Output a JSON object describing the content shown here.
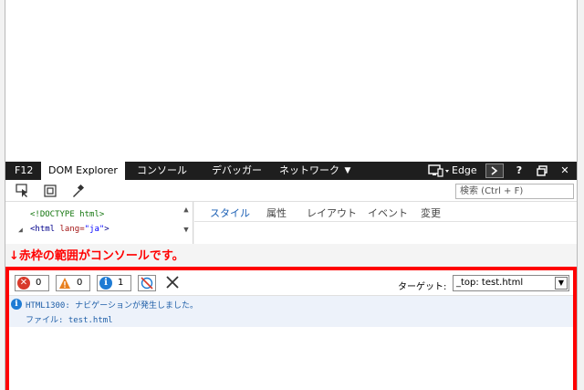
{
  "devtools": {
    "tabs": {
      "f12": "F12",
      "dom_explorer": "DOM Explorer",
      "console": "コンソール",
      "debugger": "デバッガー",
      "network": "ネットワーク"
    },
    "target_browser": "Edge",
    "search_placeholder": "検索 (Ctrl + F)"
  },
  "dom_tree": {
    "line1": "<!DOCTYPE html>",
    "line2_tag": "<html",
    "line2_attr": "lang=",
    "line2_value": "\"ja\"",
    "line2_close": ">"
  },
  "style_tabs": [
    "スタイル",
    "属性",
    "レイアウト",
    "イベント",
    "変更"
  ],
  "annotation": "↓赤枠の範囲がコンソールです。",
  "console": {
    "errors_count": "0",
    "warnings_count": "0",
    "info_count": "1",
    "target_label": "ターゲット:",
    "target_value": "_top: test.html",
    "messages": [
      {
        "line1": "HTML1300: ナビゲーションが発生しました。",
        "line2": "ファイル: test.html"
      }
    ]
  },
  "colors": {
    "highlight_border": "#ff0000",
    "annotation_text": "#ff0000",
    "active_style_tab": "#1a5fb4",
    "devtools_tabbar": "#1e1e1e"
  },
  "icons": [
    "select-element-icon",
    "dom-box-icon",
    "color-picker-icon",
    "emulation-icon",
    "console-icon",
    "help-icon",
    "undock-icon",
    "close-icon",
    "error-icon",
    "warning-icon",
    "info-icon",
    "clear-on-navigate-icon",
    "clear-console-icon"
  ]
}
